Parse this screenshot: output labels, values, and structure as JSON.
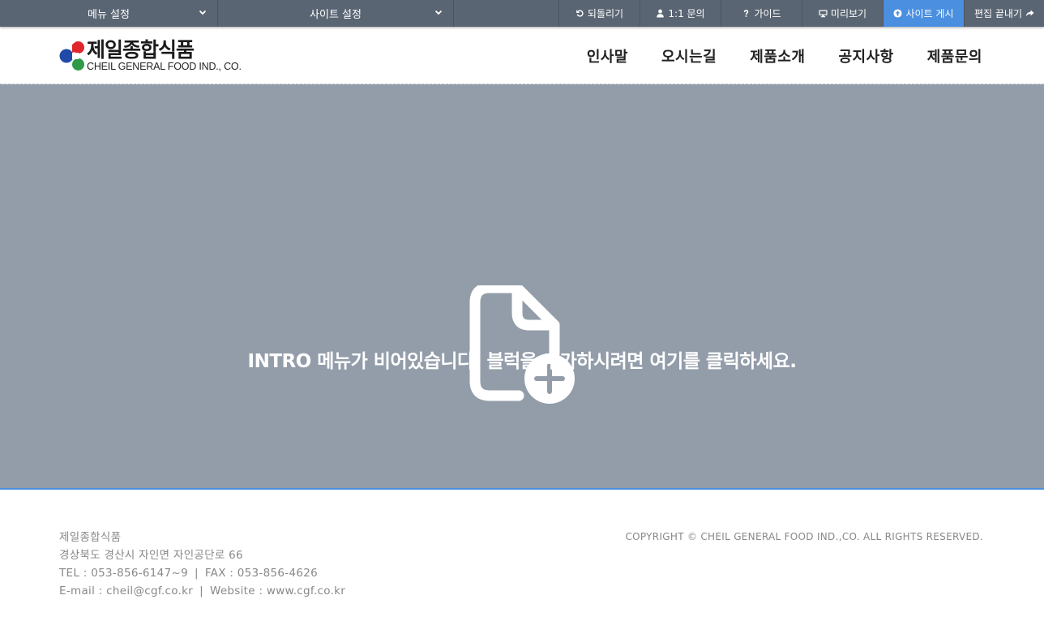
{
  "admin_bar": {
    "menu_setting": "메뉴 설정",
    "site_setting": "사이트 설정",
    "undo": "되돌리기",
    "inquiry": "1:1 문의",
    "guide": "가이드",
    "preview": "미리보기",
    "publish": "사이트 게시",
    "end_edit": "편집 끝내기",
    "publish_color": "#4a8fe0"
  },
  "header": {
    "logo_ko": "제일종합식품",
    "logo_en": "CHEIL GENERAL FOOD IND., CO.",
    "nav": [
      "인사말",
      "오시는길",
      "제품소개",
      "공지사항",
      "제품문의"
    ]
  },
  "intro": {
    "message": "INTRO 메뉴가 비어있습니다. 블럭을 추가하시려면 여기를 클릭하세요.",
    "background": "#939daa",
    "icon": "file-add-icon"
  },
  "footer": {
    "company": "제일종합식품",
    "address": "경상북도 경산시 자인면 자인공단로 66",
    "tel": "TEL : 053-856-6147~9",
    "fax": "FAX : 053-856-4626",
    "email": "E-mail : cheil@cgf.co.kr",
    "website": "Website : www.cgf.co.kr",
    "separator": "|",
    "copyright": "COPYRIGHT © CHEIL GENERAL FOOD IND.,CO. ALL RIGHTS RESERVED."
  }
}
